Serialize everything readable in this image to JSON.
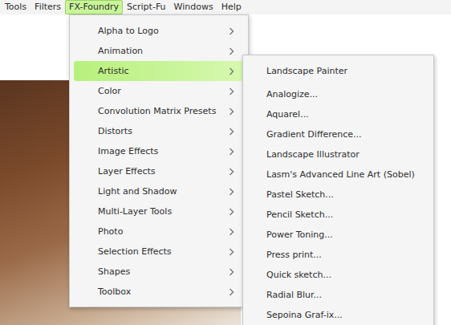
{
  "menubar": [
    {
      "label": "Tools",
      "selected": false
    },
    {
      "label": "Filters",
      "selected": false
    },
    {
      "label": "FX-Foundry",
      "selected": true
    },
    {
      "label": "Script-Fu",
      "selected": false
    },
    {
      "label": "Windows",
      "selected": false
    },
    {
      "label": "Help",
      "selected": false
    }
  ],
  "menu": {
    "items": [
      {
        "label": "Alpha to Logo",
        "selected": false
      },
      {
        "label": "Animation",
        "selected": false
      },
      {
        "label": "Artistic",
        "selected": true
      },
      {
        "label": "Color",
        "selected": false
      },
      {
        "label": "Convolution Matrix Presets",
        "selected": false
      },
      {
        "label": "Distorts",
        "selected": false
      },
      {
        "label": "Image Effects",
        "selected": false
      },
      {
        "label": "Layer Effects",
        "selected": false
      },
      {
        "label": "Light and Shadow",
        "selected": false
      },
      {
        "label": "Multi-Layer Tools",
        "selected": false
      },
      {
        "label": "Photo",
        "selected": false
      },
      {
        "label": "Selection Effects",
        "selected": false
      },
      {
        "label": "Shapes",
        "selected": false
      },
      {
        "label": "Toolbox",
        "selected": false
      }
    ]
  },
  "submenu": {
    "items": [
      "Landscape Painter",
      "Analogize...",
      "Aquarel...",
      "Gradient Difference...",
      "Landscape Illustrator",
      "Lasm's Advanced Line Art (Sobel)",
      "Pastel Sketch...",
      "Pencil Sketch...",
      "Power Toning...",
      "Press print...",
      "Quick sketch...",
      "Radial Blur...",
      "Sepoina Graf-ix..."
    ]
  }
}
